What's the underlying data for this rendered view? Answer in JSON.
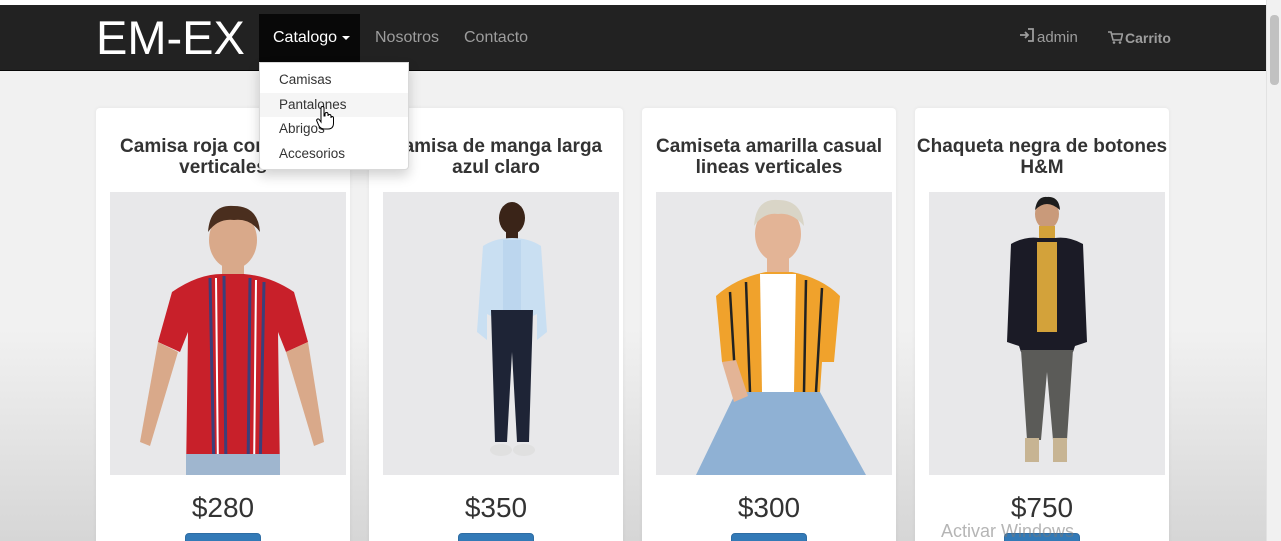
{
  "brand": "EM-EX",
  "nav": {
    "catalogo": "Catalogo",
    "nosotros": "Nosotros",
    "contacto": "Contacto",
    "admin": "admin",
    "carrito": "Carrito"
  },
  "dropdown": {
    "items": [
      "Camisas",
      "Pantalones",
      "Abrigos",
      "Accesorios"
    ],
    "hovered": "Pantalones"
  },
  "products": [
    {
      "title": "Camisa roja con lineas verticales",
      "price": "$280"
    },
    {
      "title": "Camisa de manga larga azul claro",
      "price": "$350"
    },
    {
      "title": "Camiseta amarilla casual lineas verticales",
      "price": "$300"
    },
    {
      "title": "Chaqueta negra de botones H&M",
      "price": "$750"
    }
  ],
  "watermark": "Activar Windows",
  "colors": {
    "navbar": "#222222",
    "navbar_active": "#080808",
    "button_primary": "#337ab7"
  }
}
